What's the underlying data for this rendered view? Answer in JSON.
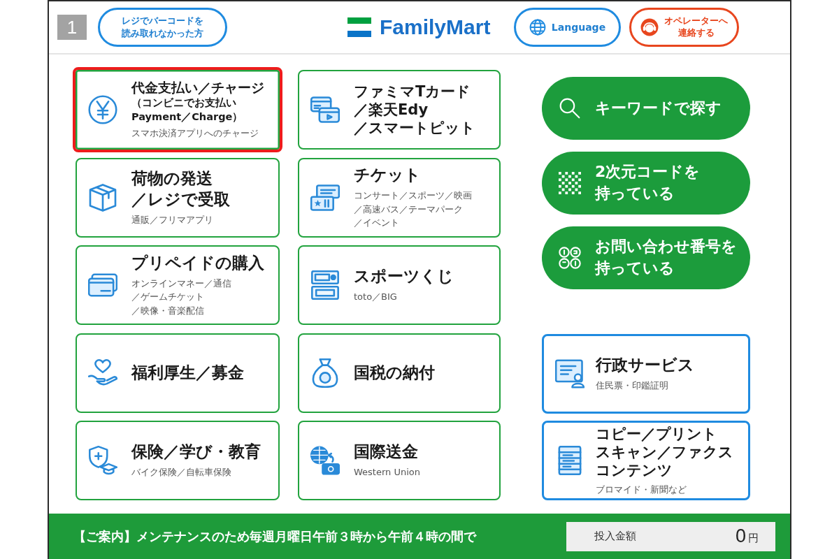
{
  "header": {
    "page_number": "1",
    "barcode_help_button": [
      "レジでバーコードを",
      "読み取れなかった方"
    ],
    "logo": "FamilyMart",
    "language_button": "Language",
    "operator_button": [
      "オペレーターへ",
      "連絡する"
    ]
  },
  "service_tiles": [
    {
      "title": "代金支払い／チャージ",
      "note": [
        "（コンビニでお支払い",
        "Payment／Charge）"
      ],
      "subtitle": "スマホ決済アプリへのチャージ",
      "selected": true
    },
    {
      "title": [
        "ファミマTカード",
        "／楽天Edy",
        "／スマートピット"
      ],
      "selected": false
    },
    {
      "title": [
        "荷物の発送",
        "／レジで受取"
      ],
      "subtitle": "通販／フリマアプリ",
      "selected": false
    },
    {
      "title": "チケット",
      "subtitle": [
        "コンサート／スポーツ／映画",
        "／高速バス／テーマパーク",
        "／イベント"
      ],
      "selected": false
    },
    {
      "title": "プリペイドの購入",
      "subtitle": [
        "オンラインマネー／通信",
        "／ゲームチケット",
        "／映像・音楽配信"
      ],
      "selected": false
    },
    {
      "title": "スポーツくじ",
      "subtitle": "toto／BIG",
      "selected": false
    },
    {
      "title": "福利厚生／募金",
      "selected": false
    },
    {
      "title": "国税の納付",
      "selected": false
    },
    {
      "title": "保険／学び・教育",
      "subtitle": "バイク保険／自転車保険",
      "selected": false
    },
    {
      "title": "国際送金",
      "subtitle": "Western Union",
      "selected": false
    }
  ],
  "search_buttons": [
    "キーワードで探す",
    [
      "2次元コードを",
      "持っている"
    ],
    [
      "お問い合わせ番号を",
      "持っている"
    ]
  ],
  "office_tiles": [
    {
      "title": "行政サービス",
      "subtitle": "住民票・印鑑証明",
      "selected": false
    },
    {
      "title": [
        "コピー／プリント",
        "スキャン／ファクス",
        "コンテンツ"
      ],
      "subtitle": "ブロマイド・新聞など",
      "selected": false
    }
  ],
  "footer": {
    "notice": "【ご案内】メンテナンスのため毎週月曜日午前３時から午前４時の間で",
    "deposit_label": "投入金額",
    "deposit_amount": "0",
    "currency": "円"
  }
}
